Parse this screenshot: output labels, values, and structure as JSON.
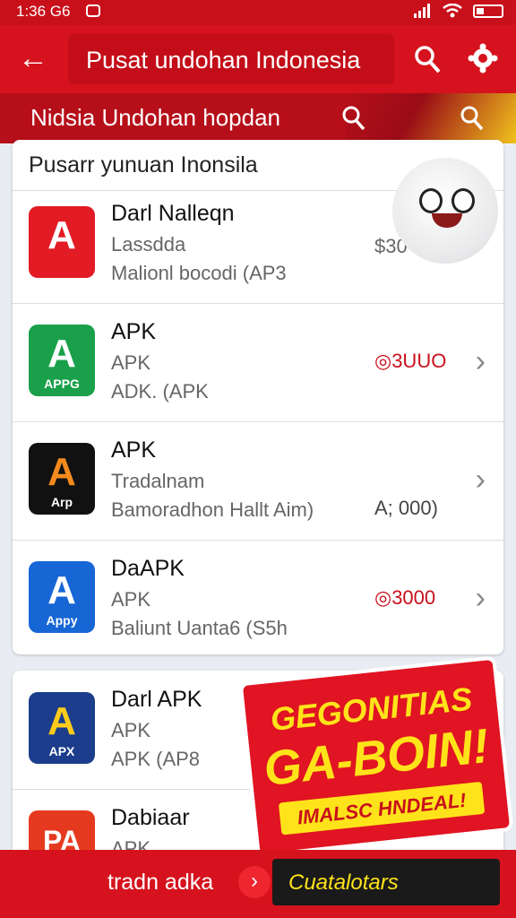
{
  "status_bar": {
    "time": "1:36 G6"
  },
  "header": {
    "title": "Pusat undohan Indonesia"
  },
  "subbar": {
    "label": "Nidsia Undohan hopdan"
  },
  "list_card": {
    "heading": "Pusarr yunuan Inonsila",
    "items": [
      {
        "name": "Darl Nalleqn",
        "line2": "Lassdda",
        "line3": "Malionl bocodi (AP3",
        "price": "$30",
        "icon_caption": "",
        "icon_color": "#e21b25"
      },
      {
        "name": "APK",
        "line2": "APK",
        "line3": "ADK. (APK",
        "price": "◎3UUO",
        "icon_caption": "APPG",
        "icon_color": "#1aa04a"
      },
      {
        "name": "APK",
        "line2": "Tradalnam",
        "line3": "Bamoradhon Hallt Aim)",
        "price": "A;  000)",
        "icon_caption": "Arp",
        "icon_color": "#111111"
      },
      {
        "name": "DaAPK",
        "line2": "APK",
        "line3": "Baliunt Uanta6 (S5h",
        "price": "◎3000",
        "icon_caption": "Appy",
        "icon_color": "#1766d6"
      }
    ]
  },
  "list_card2": {
    "items": [
      {
        "name": "Darl APK",
        "line2": "APK",
        "line3": "APK (AP8",
        "icon_caption": "APX",
        "icon_color": "#1b3d8c"
      },
      {
        "name": "Dabiaar",
        "line2": "APK",
        "icon_caption": "PA",
        "icon_color": "#e53a1f"
      }
    ]
  },
  "promo": {
    "line1": "GEGONITIAS",
    "line2": "GA-BOIN!",
    "line3": "IMALSC HNDEAL!"
  },
  "bottom_bar": {
    "label": "tradn adka",
    "cta": "Cuatalotars"
  },
  "colors": {
    "brand_red": "#d5121d",
    "accent_yellow": "#ffe31a"
  },
  "icons": [
    "back-arrow-icon",
    "search-icon",
    "settings-gear-icon",
    "wifi-icon",
    "battery-icon",
    "chevron-right-icon"
  ]
}
